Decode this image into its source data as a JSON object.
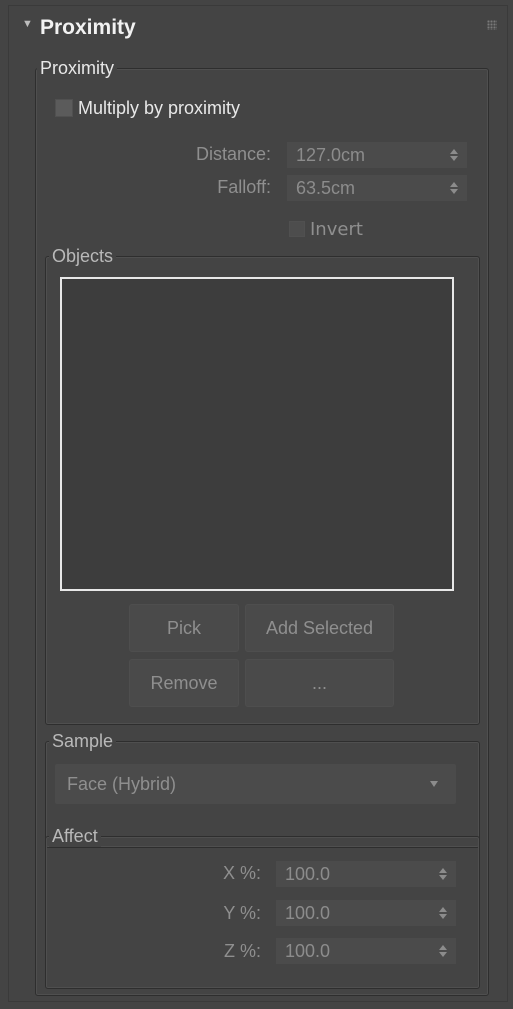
{
  "rollout": {
    "title": "Proximity"
  },
  "proximity_group": {
    "label": "Proximity",
    "multiply_label": "Multiply by proximity",
    "distance_label": "Distance:",
    "distance_value": "127.0cm",
    "falloff_label": "Falloff:",
    "falloff_value": "63.5cm",
    "invert_label": "Invert"
  },
  "objects_group": {
    "label": "Objects",
    "pick_label": "Pick",
    "add_selected_label": "Add Selected",
    "remove_label": "Remove",
    "more_label": "..."
  },
  "sample_group": {
    "label": "Sample",
    "selected": "Face (Hybrid)"
  },
  "affect_group": {
    "label": "Affect",
    "x_label": "X %:",
    "x_value": "100.0",
    "y_label": "Y %:",
    "y_value": "100.0",
    "z_label": "Z %:",
    "z_value": "100.0"
  }
}
